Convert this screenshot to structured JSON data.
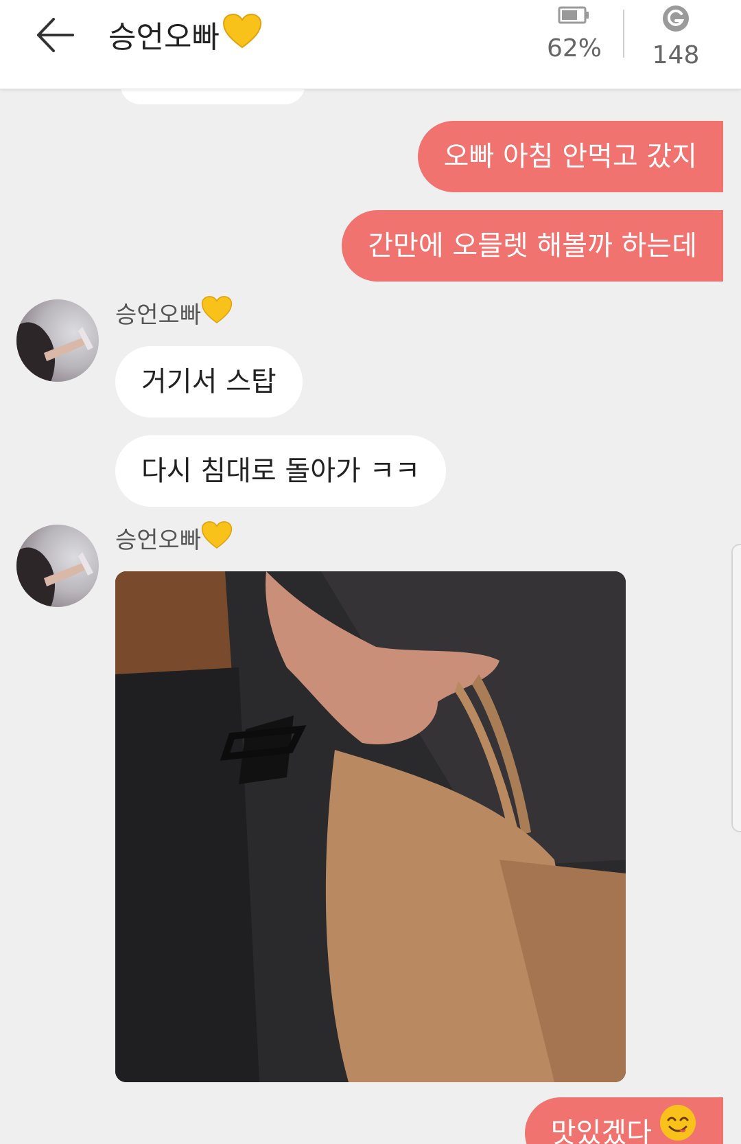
{
  "header": {
    "title": "승언오빠",
    "battery": {
      "label": "62%"
    },
    "coins": {
      "label": "148"
    }
  },
  "messages": {
    "me_1": "오빠 아침 안먹고 갔지",
    "me_2": "간만에 오믈렛 해볼까 하는데",
    "sender_name": "승언오빠",
    "them_1": "거기서 스탑",
    "them_2": "다시 침대로 돌아가 ㅋㅋ",
    "me_3": "맛있겠다"
  },
  "colors": {
    "accent": "#f07370",
    "heart": "#f8c21a"
  }
}
